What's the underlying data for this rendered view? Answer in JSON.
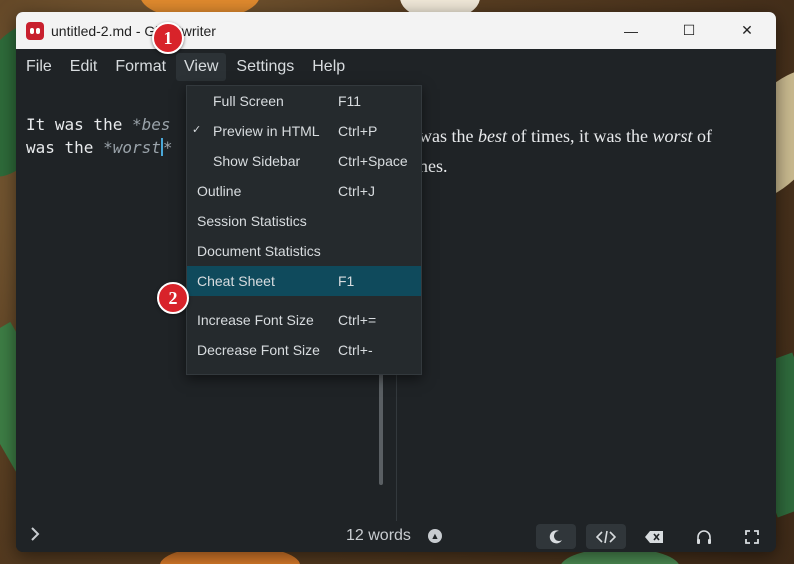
{
  "window": {
    "title": "untitled-2.md - Ghostwriter",
    "minimize": "—",
    "maximize": "☐",
    "close": "✕"
  },
  "menubar": [
    {
      "label": "File"
    },
    {
      "label": "Edit"
    },
    {
      "label": "Format"
    },
    {
      "label": "View"
    },
    {
      "label": "Settings"
    },
    {
      "label": "Help"
    }
  ],
  "editor": {
    "line1_prefix": "It was the ",
    "line1_md": "*bes",
    "line2_prefix": "was the ",
    "line2_md": "*worst",
    "line2_suffix": "*"
  },
  "preview": {
    "seg1": "was the ",
    "best": "best",
    "seg2": " of times, it was the ",
    "worst": "worst",
    "seg3": " of",
    "line2": "nes."
  },
  "view_menu": {
    "items": [
      {
        "label": "Full Screen",
        "shortcut": "F11",
        "checked": false
      },
      {
        "label": "Preview in HTML",
        "shortcut": "Ctrl+P",
        "checked": true
      },
      {
        "label": "Show Sidebar",
        "shortcut": "Ctrl+Space",
        "checked": false
      },
      {
        "label": "Outline",
        "shortcut": "Ctrl+J",
        "checked": false
      },
      {
        "label": "Session Statistics",
        "shortcut": "",
        "checked": false
      },
      {
        "label": "Document Statistics",
        "shortcut": "",
        "checked": false
      },
      {
        "label": "Cheat Sheet",
        "shortcut": "F1",
        "checked": false
      },
      {
        "label": "Increase Font Size",
        "shortcut": "Ctrl+=",
        "checked": false
      },
      {
        "label": "Decrease Font Size",
        "shortcut": "Ctrl+-",
        "checked": false
      }
    ]
  },
  "annotations": {
    "badge1": "1",
    "badge2": "2"
  },
  "statusbar": {
    "word_count": "12 words",
    "icons": [
      "chevron-right-icon",
      "moon-icon",
      "code-icon",
      "backspace-icon",
      "headphones-icon",
      "fullscreen-icon"
    ]
  },
  "colors": {
    "highlight": "#0f4a5c",
    "badge": "#d8232a",
    "background": "#1f2326"
  }
}
